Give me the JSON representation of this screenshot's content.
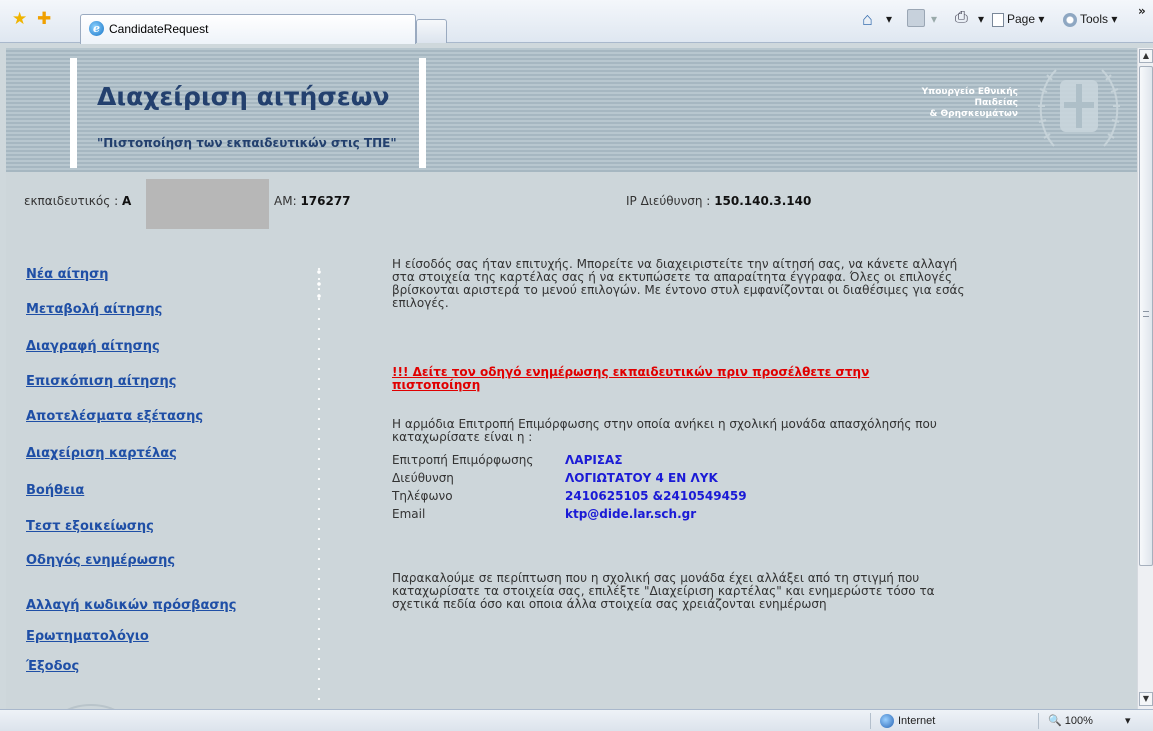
{
  "browser": {
    "tab_title": "CandidateRequest",
    "home_caret": "▾",
    "feed_caret": "▾",
    "print_caret": "▾",
    "page_menu": "Page",
    "tools_menu": "Tools",
    "overflow_chevron": "»",
    "status_zone": "Internet",
    "zoom": "100%",
    "zoom_caret": "▾"
  },
  "header": {
    "title": "Διαχείριση αιτήσεων",
    "subtitle": "\"Πιστοποίηση των εκπαιδευτικών στις ΤΠΕ\"",
    "ministry_line1": "Υπουργείο Εθνικής",
    "ministry_line2": "Παιδείας",
    "ministry_line3": "& Θρησκευμάτων"
  },
  "user_info": {
    "teacher_label": "εκπαιδευτικός :",
    "teacher_initial": "Α",
    "am_label": "ΑΜ:",
    "am_value": "176277",
    "ip_label": "IP Διεύθυνση :",
    "ip_value": "150.140.3.140"
  },
  "menu": {
    "items": [
      {
        "label": "Νέα αίτηση"
      },
      {
        "label": "Μεταβολή αίτησης"
      },
      {
        "label": "Διαγραφή αίτησης"
      },
      {
        "label": "Επισκόπιση αίτησης"
      },
      {
        "label": "Αποτελέσματα εξέτασης"
      },
      {
        "label": "Διαχείριση καρτέλας"
      },
      {
        "label": "Βοήθεια"
      },
      {
        "label": "Τεστ εξοικείωσης"
      },
      {
        "label": "Οδηγός ενημέρωσης"
      },
      {
        "label": "Αλλαγή κωδικών πρόσβασης"
      },
      {
        "label": "Ερωτηματολόγιο"
      },
      {
        "label": "Έξοδος"
      }
    ]
  },
  "content": {
    "welcome": "Η είσοδός σας ήταν επιτυχής. Μπορείτε να διαχειριστείτε την αίτησή σας, να κάνετε αλλαγή στα στοιχεία της καρτέλας σας ή να εκτυπώσετε τα απαραίτητα έγγραφα. Όλες οι επιλογές βρίσκονται αριστερά το μενού επιλογών. Με έντονο στυλ εμφανίζονται οι διαθέσιμες για εσάς επιλογές.",
    "notice_link": "!!! Δείτε τον οδηγό ενημέρωσης εκπαιδευτικών πριν προσέλθετε στην πιστοποίηση",
    "committee_intro": "Η αρμόδια Επιτροπή Επιμόρφωσης στην οποία ανήκει η σχολική μονάδα απασχόλησής που καταχωρίσατε είναι η :",
    "committee": {
      "label": "Επιτροπή Επιμόρφωσης",
      "value": "ΛΑΡΙΣΑΣ"
    },
    "address": {
      "label": "Διεύθυνση",
      "value": "ΛΟΓΙΩΤΑΤΟΥ 4 ΕΝ ΛΥΚ"
    },
    "phone": {
      "label": "Τηλέφωνο",
      "value": "2410625105 &2410549459"
    },
    "email": {
      "label": "Email",
      "value": "ktp@dide.lar.sch.gr"
    },
    "request": "Παρακαλούμε σε περίπτωση που η σχολική σας μονάδα έχει αλλάξει από τη στιγμή που καταχωρίσατε τα στοιχεία σας, επιλέξτε \"Διαχείριση καρτέλας\" και ενημερώστε τόσο τα σχετικά πεδία όσο και οποια άλλα στοιχεία σας χρειάζονται ενημέρωση"
  },
  "colors": {
    "banner": "#aebfc8",
    "title": "#23406e",
    "menu_link": "#1f4fa6",
    "alert": "#e00000",
    "value": "#1a1ad6"
  }
}
